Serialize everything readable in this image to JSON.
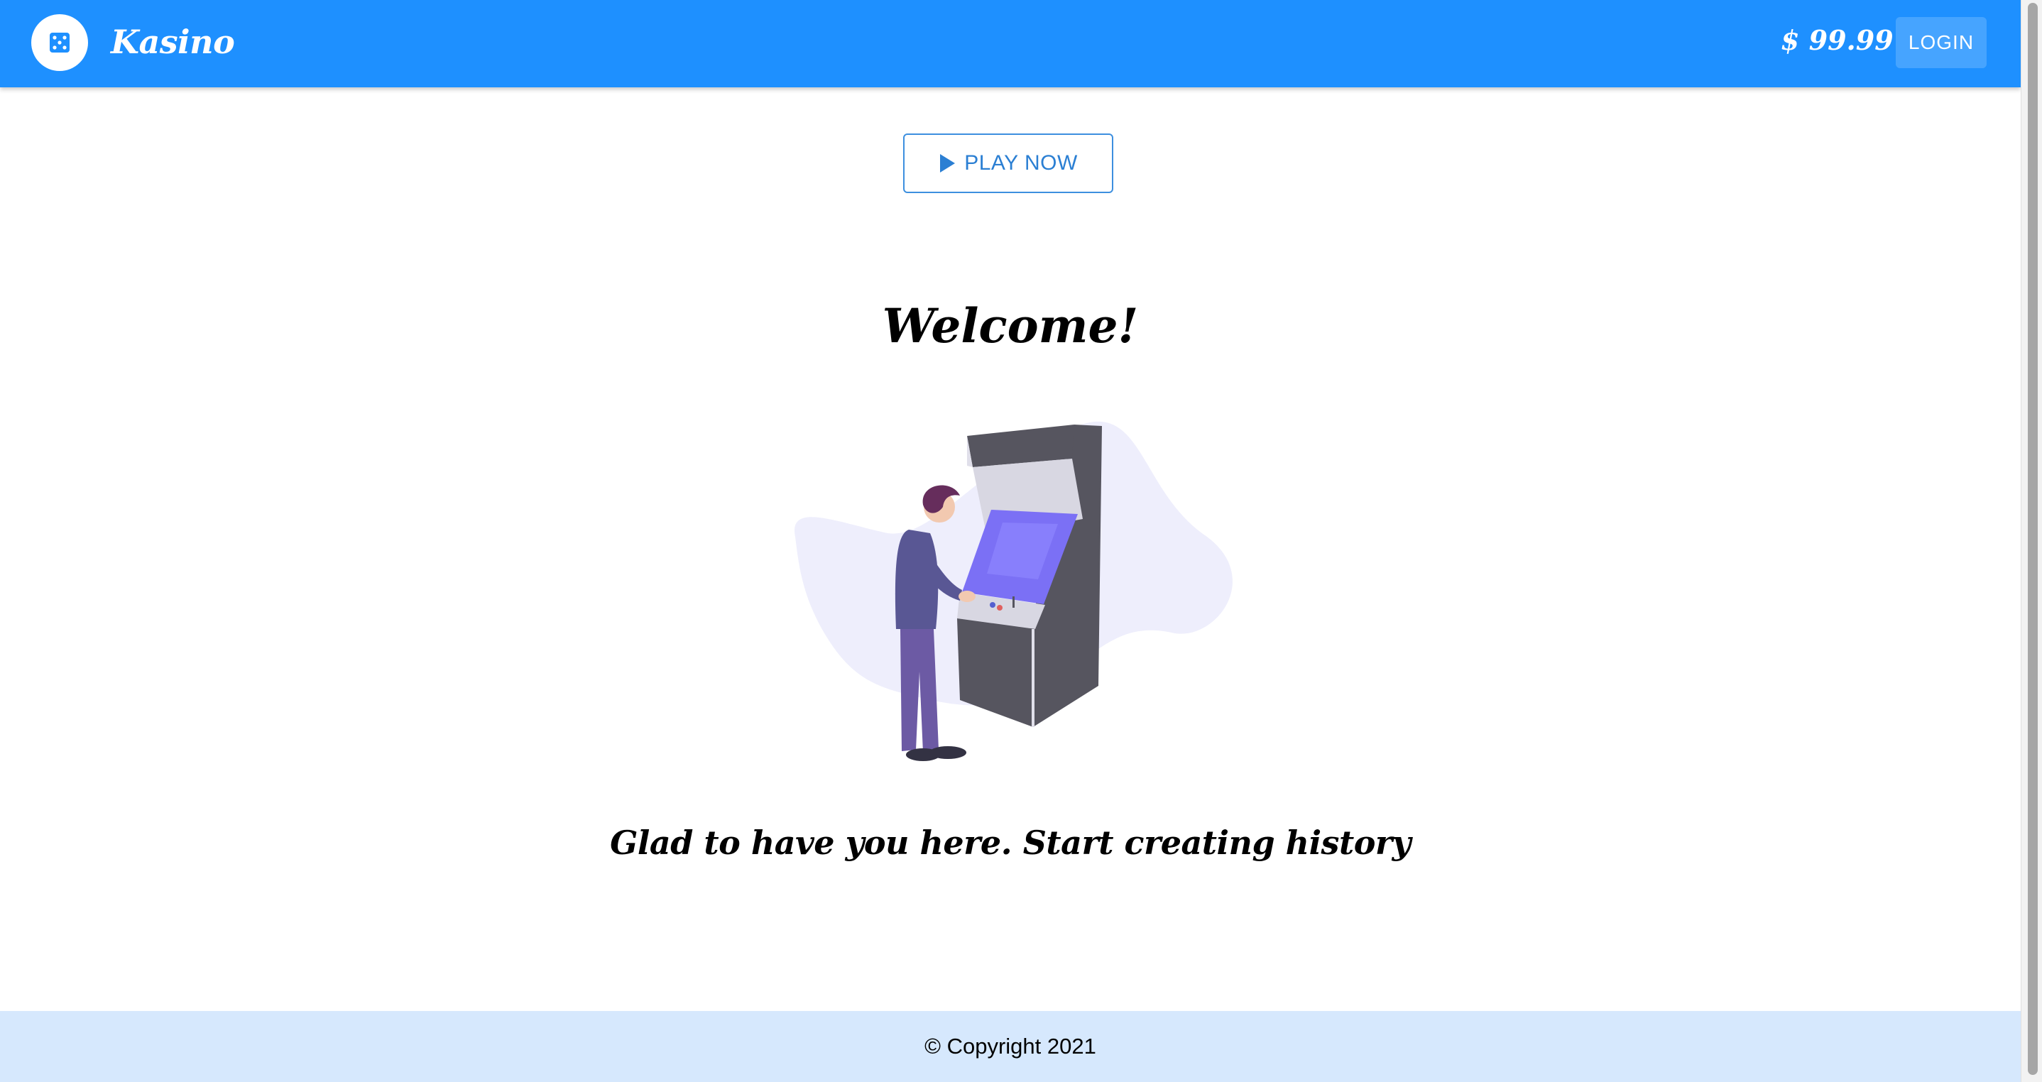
{
  "appbar": {
    "logo_icon": "dice-icon",
    "brand": "Kasino",
    "balance": "$ 99.99",
    "login_label": "LOGIN",
    "color": "#1e90ff"
  },
  "main": {
    "play_label": "PLAY NOW",
    "play_icon": "play-icon",
    "welcome": "Welcome!",
    "illustration": "arcade-player-illustration",
    "tagline": "Glad to have you here. Start creating history"
  },
  "footer": {
    "copyright": "© Copyright 2021",
    "color": "#d6e8fd"
  }
}
